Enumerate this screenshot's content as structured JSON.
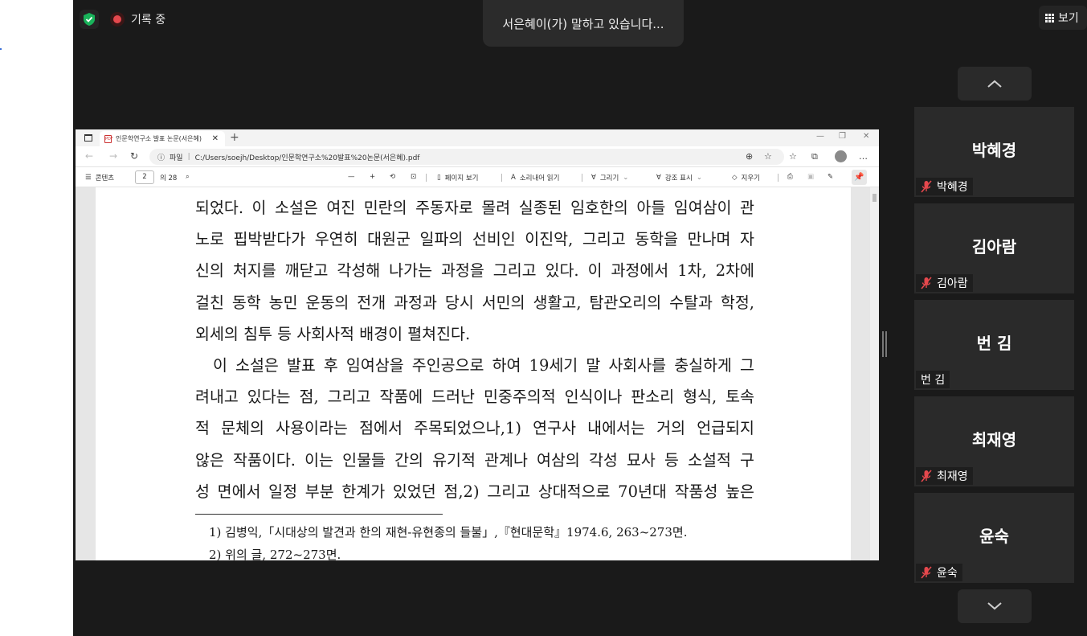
{
  "meeting": {
    "recording_label": "기록 중",
    "speaking_banner": "서은혜이(가) 말하고 있습니다...",
    "view_button_label": "보기"
  },
  "participants": [
    {
      "name": "박혜경",
      "label": "박혜경",
      "muted": true
    },
    {
      "name": "김아람",
      "label": "김아람",
      "muted": true
    },
    {
      "name": "번 김",
      "label": "번 김",
      "muted": false
    },
    {
      "name": "최재영",
      "label": "최재영",
      "muted": true
    },
    {
      "name": "윤숙",
      "label": "윤숙",
      "muted": true
    }
  ],
  "browser": {
    "tab_title": "인문학연구소 발표 논문(서은혜)",
    "address_prefix": "파일",
    "address_url": "C:/Users/soejh/Desktop/인문학연구소%20발표%20논문(서은혜).pdf"
  },
  "pdf_toolbar": {
    "contents_label": "콘텐츠",
    "page_current": "2",
    "page_total": "의 28",
    "page_view_label": "페이지 보기",
    "read_aloud_label": "소리내어 읽기",
    "draw_label": "그리기",
    "highlight_label": "강조 표시",
    "erase_label": "지우기"
  },
  "document": {
    "lines": [
      "되었다. 이 소설은 여진 민란의 주동자로 몰려 실종된 임호한의 아들 임여삼이 관",
      "노로 핍박받다가 우연히 대원군 일파의 선비인 이진악, 그리고 동학을 만나며 자",
      "신의 처지를 깨닫고 각성해 나가는 과정을 그리고 있다. 이 과정에서 1차, 2차에",
      "걸친 동학 농민 운동의 전개 과정과 당시 서민의 생활고, 탐관오리의 수탈과 학정,",
      "외세의 침투 등 사회사적 배경이 펼쳐진다.",
      "이 소설은 발표 후 임여삼을 주인공으로 하여 19세기 말 사회사를 충실하게 그",
      "려내고 있다는 점, 그리고 작품에 드러난 민중주의적 인식이나 판소리 형식, 토속",
      "적 문체의 사용이라는 점에서 주목되었으나,1) 연구사 내에서는 거의 언급되지",
      "않은 작품이다. 이는 인물들 간의 유기적 관계나 여삼의 각성 묘사 등 소설적 구",
      "성 면에서 일정 부분 한계가 있었던 점,2) 그리고 상대적으로 70년대 작품성 높은"
    ],
    "footnotes": [
      "1) 김병익,「시대상의 발견과 한의 재현-유현종의 들불」,『현대문학』1974.6, 263~273면.",
      "2) 위의 글, 272~273면."
    ]
  }
}
